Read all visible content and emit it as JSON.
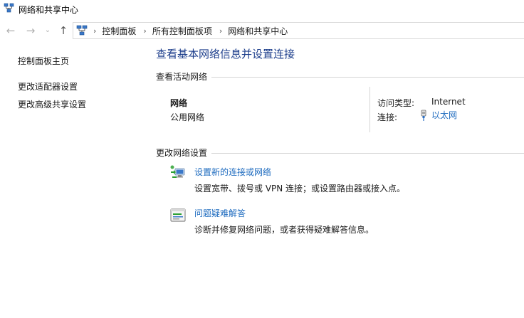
{
  "window": {
    "title": "网络和共享中心"
  },
  "nav": {
    "back_glyph": "←",
    "forward_glyph": "→",
    "recent_glyph": "⌄",
    "up_glyph": "↑"
  },
  "breadcrumb": {
    "sep": "›",
    "items": [
      "控制面板",
      "所有控制面板项",
      "网络和共享中心"
    ]
  },
  "sidebar": {
    "items": [
      {
        "label": "控制面板主页"
      },
      {
        "label": "更改适配器设置"
      },
      {
        "label": "更改高级共享设置"
      }
    ]
  },
  "main": {
    "title": "查看基本网络信息并设置连接",
    "active_networks": {
      "header": "查看活动网络",
      "network_name": "网络",
      "network_type": "公用网络",
      "access_type_label": "访问类型:",
      "access_type_value": "Internet",
      "connection_label": "连接:",
      "connection_value": "以太网"
    },
    "change_settings": {
      "header": "更改网络设置",
      "tasks": [
        {
          "link": "设置新的连接或网络",
          "desc": "设置宽带、拨号或 VPN 连接；或设置路由器或接入点。"
        },
        {
          "link": "问题疑难解答",
          "desc": "诊断并修复网络问题，或者获得疑难解答信息。"
        }
      ]
    }
  },
  "colors": {
    "title_blue": "#1e3f8c",
    "link_blue": "#1e6bbf",
    "divider": "#d4d4d4"
  }
}
